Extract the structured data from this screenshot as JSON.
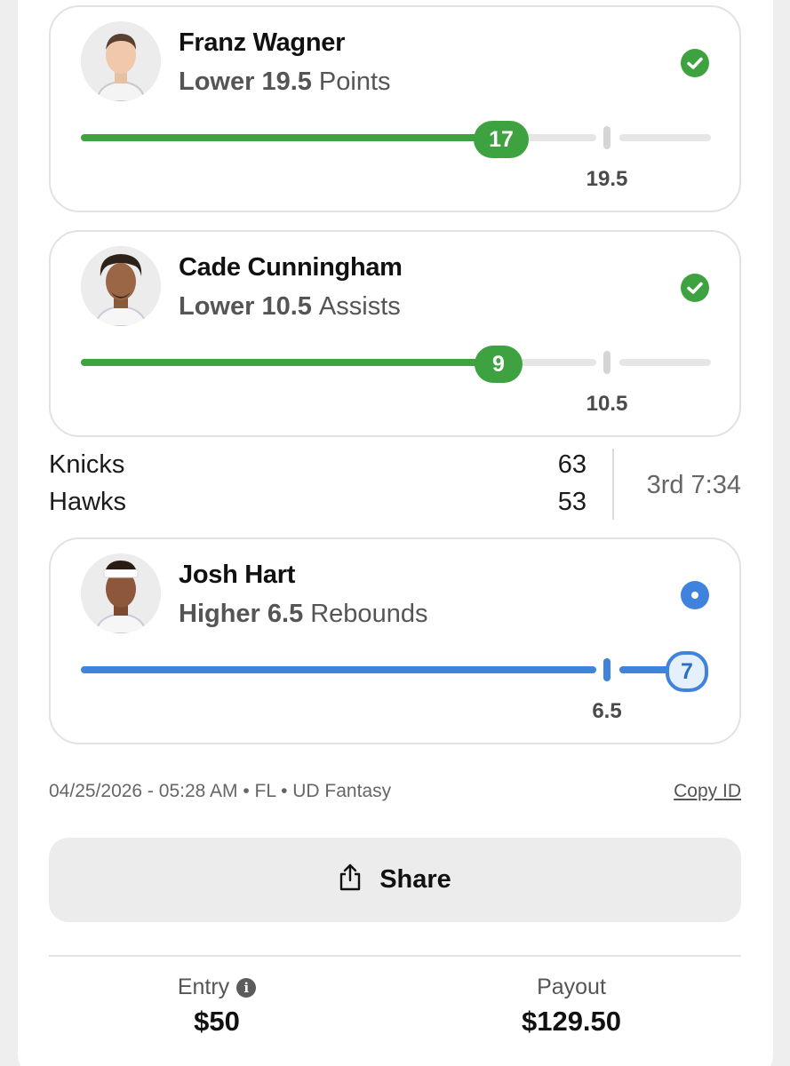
{
  "picks": [
    {
      "player": "Franz Wagner",
      "direction": "Lower",
      "line": "19.5",
      "stat": "Points",
      "current": "17",
      "line_label": "19.5",
      "status": "won",
      "color": "#3da23f"
    },
    {
      "player": "Cade Cunningham",
      "direction": "Lower",
      "line": "10.5",
      "stat": "Assists",
      "current": "9",
      "line_label": "10.5",
      "status": "won",
      "color": "#3da23f"
    },
    {
      "player": "Josh Hart",
      "direction": "Higher",
      "line": "6.5",
      "stat": "Rebounds",
      "current": "7",
      "line_label": "6.5",
      "status": "live",
      "color": "#3f83dc"
    }
  ],
  "game": {
    "home": "Knicks",
    "home_score": "63",
    "away": "Hawks",
    "away_score": "53",
    "clock": "3rd 7:34"
  },
  "meta": {
    "text": "04/25/2026 - 05:28 AM • FL • UD Fantasy",
    "copy_id": "Copy ID"
  },
  "share": {
    "label": "Share",
    "icon": "share-icon"
  },
  "footer": {
    "entry_label": "Entry",
    "entry_value": "$50",
    "payout_label": "Payout",
    "payout_value": "$129.50"
  }
}
